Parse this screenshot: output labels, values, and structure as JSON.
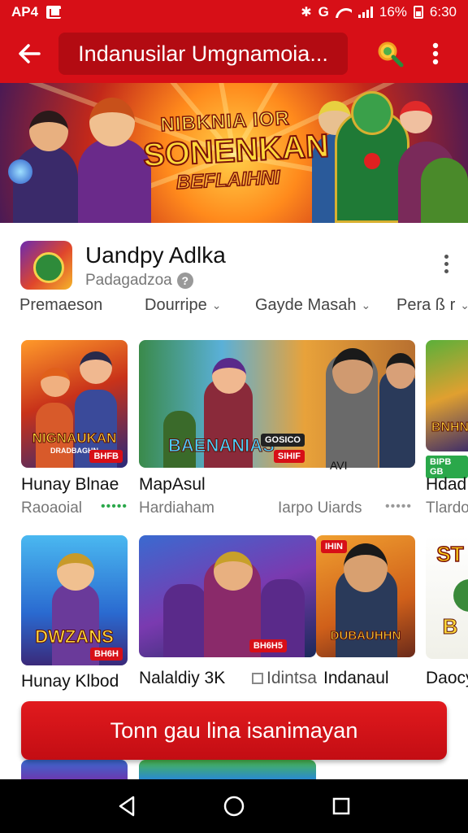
{
  "status_bar": {
    "left_text": "AP4",
    "battery_text": "16%",
    "time": "6:30"
  },
  "app_bar": {
    "title": "Indanusilar Umgnamoia..."
  },
  "banner": {
    "line1": "NIBKNIA IOR",
    "line2": "SONENKAN",
    "line3": "BEFLAIHNI"
  },
  "developer": {
    "name": "Uandpy Adlka",
    "subtitle": "Padagadzoa"
  },
  "filters": [
    {
      "label": "Premaeson",
      "caret": ""
    },
    {
      "label": "Dourripe",
      "caret": "⌄"
    },
    {
      "label": "Gayde Masah",
      "caret": "⌄"
    },
    {
      "label": "Pera ß r",
      "caret": "⌄"
    }
  ],
  "row1": [
    {
      "art_title": "NIGNAUKAN",
      "art_sub": "DRADBAGHN",
      "tag": "BHFB",
      "label": "Hunay Blnae",
      "sub": "Raoaoial",
      "dots": "•••••"
    },
    {
      "art_title": "BAENANIAS",
      "art_sub": "",
      "tag": "SIHIF",
      "tag2": "GOSICO",
      "label": "MapAsul",
      "sub": "Hardiaham",
      "dots": ""
    },
    {
      "art_title": "",
      "art_sub": "",
      "tag": "",
      "label": "",
      "sub": "Iarpo Uiards",
      "dots": "•••••",
      "mini": "AVI"
    },
    {
      "art_title": "BNHN",
      "art_sub": "",
      "tag": "BIPB GB",
      "label": "Hdad",
      "sub": "Tlardo",
      "dots": ""
    }
  ],
  "row2": [
    {
      "art_title": "DWZANS",
      "tag": "BH6H",
      "label": "Hunay Klbod",
      "sub": ""
    },
    {
      "art_title": "",
      "tag": "BH6H5",
      "label": "Nalaldiy 3K",
      "sub": ""
    },
    {
      "art_title": "DUBAUHHN",
      "tag": "IHIN",
      "label": "Indanaul",
      "sub": "",
      "checkbox_label": "Idintsa"
    },
    {
      "art_title": "ST",
      "art_sub": "B",
      "tag": "",
      "label": "Daocy",
      "sub": ""
    }
  ],
  "cta": {
    "label": "Tonn gau lina isanimayan"
  },
  "colors": {
    "primary_red": "#d70f17",
    "dark_red": "#b30b12",
    "nav_black": "#000000"
  }
}
